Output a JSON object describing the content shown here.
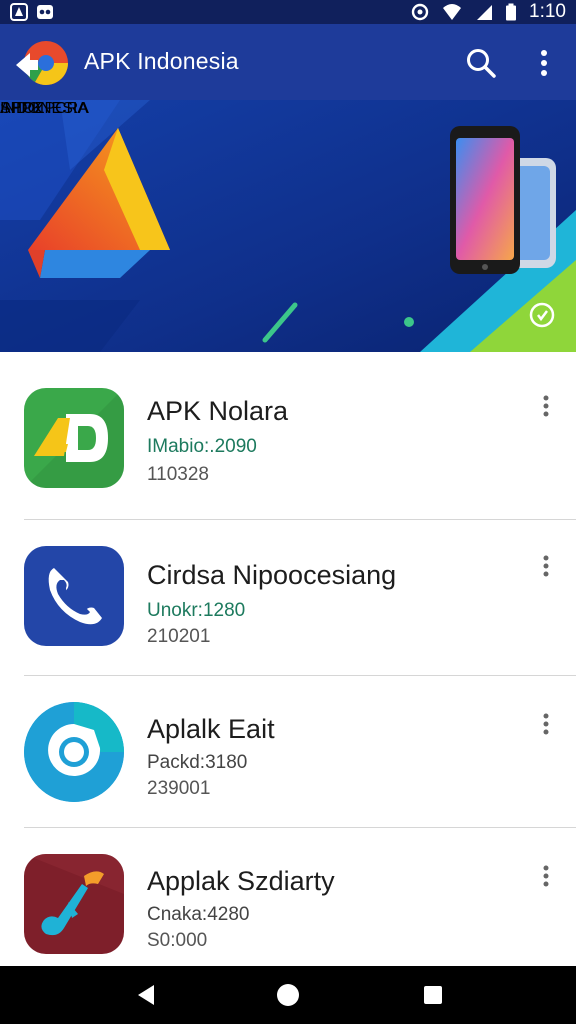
{
  "status_bar": {
    "time": "1:10",
    "left_icons": [
      "app-notification-icon",
      "voicemail-icon"
    ],
    "right_icons": [
      "sync-icon",
      "wifi-icon",
      "signal-icon",
      "battery-icon"
    ]
  },
  "app_bar": {
    "title": "APK Indonesia",
    "actions": [
      "search-icon",
      "more-vert-icon"
    ]
  },
  "banner": {
    "line1": "APPK",
    "line2": "INDONESIA",
    "caption": "SHOZPCRA"
  },
  "apps": [
    {
      "name": "APK Nolara",
      "meta1": "IMabio:.2090",
      "meta2": "110328",
      "icon": "ad-logo-icon",
      "icon_color": "#3aa84a"
    },
    {
      "name": "Cirdsa Nipoocesiang",
      "meta1": "Unokr:1280",
      "meta2": "210201",
      "icon": "phone-icon",
      "icon_color": "#2346a8"
    },
    {
      "name": "Aplalk Eait",
      "meta1": "Packd:3180",
      "meta2": "239001",
      "icon": "camera-lens-icon",
      "icon_color": "#1fa0d6"
    },
    {
      "name": "Applak Szdiarty",
      "meta1": "Cnaka:4280",
      "meta2": "S0:000",
      "icon": "music-note-icon",
      "icon_color": "#7e1f2a"
    }
  ],
  "nav_bar": [
    "back-icon",
    "home-icon",
    "recents-icon"
  ]
}
